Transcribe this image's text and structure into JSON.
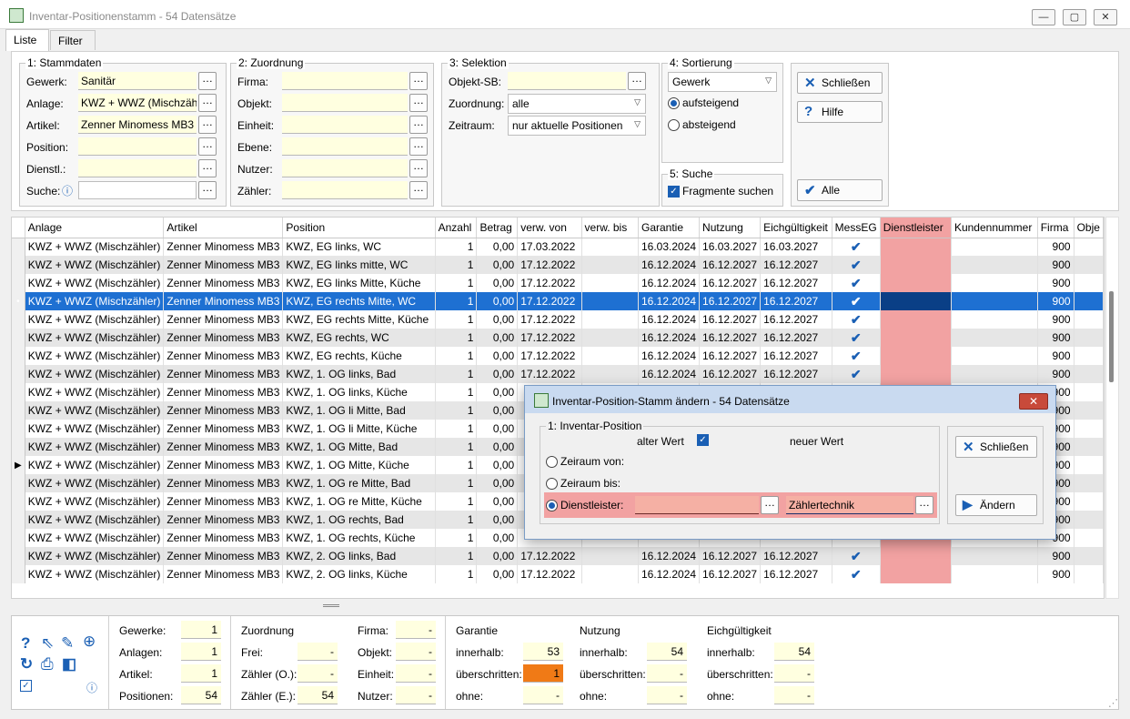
{
  "window": {
    "title": "Inventar-Positionenstamm - 54 Datensätze",
    "btn_min": "—",
    "btn_max": "▢",
    "btn_close": "✕"
  },
  "tabs": [
    "Liste",
    "Filter"
  ],
  "stammdaten": {
    "title": "1: Stammdaten",
    "rows": [
      {
        "label": "Gewerk:",
        "value": "Sanitär"
      },
      {
        "label": "Anlage:",
        "value": "KWZ + WWZ (Mischzäh"
      },
      {
        "label": "Artikel:",
        "value": "Zenner Minomess MB3"
      },
      {
        "label": "Position:",
        "value": ""
      },
      {
        "label": "Dienstl.:",
        "value": ""
      },
      {
        "label": "Suche:",
        "value": ""
      }
    ]
  },
  "zuordnung": {
    "title": "2: Zuordnung",
    "rows": [
      {
        "label": "Firma:",
        "value": ""
      },
      {
        "label": "Objekt:",
        "value": ""
      },
      {
        "label": "Einheit:",
        "value": ""
      },
      {
        "label": "Ebene:",
        "value": ""
      },
      {
        "label": "Nutzer:",
        "value": ""
      },
      {
        "label": "Zähler:",
        "value": ""
      }
    ]
  },
  "selektion": {
    "title": "3: Selektion",
    "objekt_label": "Objekt-SB:",
    "zuordnung_label": "Zuordnung:",
    "zuordnung_value": "alle",
    "zeitraum_label": "Zeitraum:",
    "zeitraum_value": "nur aktuelle Positionen"
  },
  "sortierung": {
    "title": "4: Sortierung",
    "value": "Gewerk",
    "asc": "aufsteigend",
    "desc": "absteigend"
  },
  "suche": {
    "title": "5: Suche",
    "fragment": "Fragmente suchen"
  },
  "buttons": {
    "schliessen": "Schließen",
    "hilfe": "Hilfe",
    "alle": "Alle"
  },
  "grid": {
    "columns": [
      "Anlage",
      "Artikel",
      "Position",
      "Anzahl",
      "Betrag",
      "verw. von",
      "verw. bis",
      "Garantie",
      "Nutzung",
      "Eichgültigkeit",
      "MessEG",
      "Dienstleister",
      "Kundennummer",
      "Firma",
      "Obje"
    ],
    "rows": [
      [
        "KWZ + WWZ (Mischzähler)",
        "Zenner Minomess MB3",
        "KWZ, EG links, WC",
        "1",
        "0,00",
        "17.03.2022",
        "",
        "16.03.2024",
        "16.03.2027",
        "16.03.2027",
        "✔",
        "",
        "",
        "900",
        ""
      ],
      [
        "KWZ + WWZ (Mischzähler)",
        "Zenner Minomess MB3",
        "KWZ, EG links mitte, WC",
        "1",
        "0,00",
        "17.12.2022",
        "",
        "16.12.2024",
        "16.12.2027",
        "16.12.2027",
        "✔",
        "",
        "",
        "900",
        ""
      ],
      [
        "KWZ + WWZ (Mischzähler)",
        "Zenner Minomess MB3",
        "KWZ, EG links Mitte, Küche",
        "1",
        "0,00",
        "17.12.2022",
        "",
        "16.12.2024",
        "16.12.2027",
        "16.12.2027",
        "✔",
        "",
        "",
        "900",
        ""
      ],
      [
        "KWZ + WWZ (Mischzähler)",
        "Zenner Minomess MB3",
        "KWZ, EG rechts Mitte, WC",
        "1",
        "0,00",
        "17.12.2022",
        "",
        "16.12.2024",
        "16.12.2027",
        "16.12.2027",
        "✔",
        "",
        "",
        "900",
        ""
      ],
      [
        "KWZ + WWZ (Mischzähler)",
        "Zenner Minomess MB3",
        "KWZ, EG rechts Mitte, Küche",
        "1",
        "0,00",
        "17.12.2022",
        "",
        "16.12.2024",
        "16.12.2027",
        "16.12.2027",
        "✔",
        "",
        "",
        "900",
        ""
      ],
      [
        "KWZ + WWZ (Mischzähler)",
        "Zenner Minomess MB3",
        "KWZ, EG rechts, WC",
        "1",
        "0,00",
        "17.12.2022",
        "",
        "16.12.2024",
        "16.12.2027",
        "16.12.2027",
        "✔",
        "",
        "",
        "900",
        ""
      ],
      [
        "KWZ + WWZ (Mischzähler)",
        "Zenner Minomess MB3",
        "KWZ, EG rechts, Küche",
        "1",
        "0,00",
        "17.12.2022",
        "",
        "16.12.2024",
        "16.12.2027",
        "16.12.2027",
        "✔",
        "",
        "",
        "900",
        ""
      ],
      [
        "KWZ + WWZ (Mischzähler)",
        "Zenner Minomess MB3",
        "KWZ, 1. OG links, Bad",
        "1",
        "0,00",
        "17.12.2022",
        "",
        "16.12.2024",
        "16.12.2027",
        "16.12.2027",
        "✔",
        "",
        "",
        "900",
        ""
      ],
      [
        "KWZ + WWZ (Mischzähler)",
        "Zenner Minomess MB3",
        "KWZ, 1. OG links, Küche",
        "1",
        "0,00",
        "",
        "",
        "",
        "",
        "",
        "",
        "",
        "",
        "900",
        ""
      ],
      [
        "KWZ + WWZ (Mischzähler)",
        "Zenner Minomess MB3",
        "KWZ, 1. OG li Mitte, Bad",
        "1",
        "0,00",
        "",
        "",
        "",
        "",
        "",
        "",
        "",
        "",
        "900",
        ""
      ],
      [
        "KWZ + WWZ (Mischzähler)",
        "Zenner Minomess MB3",
        "KWZ, 1. OG li Mitte, Küche",
        "1",
        "0,00",
        "",
        "",
        "",
        "",
        "",
        "",
        "",
        "",
        "900",
        ""
      ],
      [
        "KWZ + WWZ (Mischzähler)",
        "Zenner Minomess MB3",
        "KWZ, 1. OG Mitte, Bad",
        "1",
        "0,00",
        "",
        "",
        "",
        "",
        "",
        "",
        "",
        "",
        "900",
        ""
      ],
      [
        "KWZ + WWZ (Mischzähler)",
        "Zenner Minomess MB3",
        "KWZ, 1. OG Mitte, Küche",
        "1",
        "0,00",
        "",
        "",
        "",
        "",
        "",
        "",
        "",
        "",
        "900",
        ""
      ],
      [
        "KWZ + WWZ (Mischzähler)",
        "Zenner Minomess MB3",
        "KWZ, 1. OG re Mitte, Bad",
        "1",
        "0,00",
        "",
        "",
        "",
        "",
        "",
        "",
        "",
        "",
        "900",
        ""
      ],
      [
        "KWZ + WWZ (Mischzähler)",
        "Zenner Minomess MB3",
        "KWZ, 1. OG re Mitte, Küche",
        "1",
        "0,00",
        "",
        "",
        "",
        "",
        "",
        "",
        "",
        "",
        "900",
        ""
      ],
      [
        "KWZ + WWZ (Mischzähler)",
        "Zenner Minomess MB3",
        "KWZ, 1. OG rechts, Bad",
        "1",
        "0,00",
        "",
        "",
        "",
        "",
        "",
        "",
        "",
        "",
        "900",
        ""
      ],
      [
        "KWZ + WWZ (Mischzähler)",
        "Zenner Minomess MB3",
        "KWZ, 1. OG rechts, Küche",
        "1",
        "0,00",
        "",
        "",
        "",
        "",
        "",
        "",
        "",
        "",
        "900",
        ""
      ],
      [
        "KWZ + WWZ (Mischzähler)",
        "Zenner Minomess MB3",
        "KWZ, 2. OG links, Bad",
        "1",
        "0,00",
        "17.12.2022",
        "",
        "16.12.2024",
        "16.12.2027",
        "16.12.2027",
        "✔",
        "",
        "",
        "900",
        ""
      ],
      [
        "KWZ + WWZ (Mischzähler)",
        "Zenner Minomess MB3",
        "KWZ, 2. OG links, Küche",
        "1",
        "0,00",
        "17.12.2022",
        "",
        "16.12.2024",
        "16.12.2027",
        "16.12.2027",
        "✔",
        "",
        "",
        "900",
        ""
      ]
    ],
    "selected_marker": "•",
    "current_marker": "▶"
  },
  "footer": {
    "stats": [
      {
        "label": "Gewerke:",
        "value": "1"
      },
      {
        "label": "Anlagen:",
        "value": "1"
      },
      {
        "label": "Artikel:",
        "value": "1"
      },
      {
        "label": "Positionen:",
        "value": "54"
      }
    ],
    "zuordnung_title": "Zuordnung",
    "zuordnung": [
      {
        "label": "Frei:",
        "value": "-"
      },
      {
        "label": "Zähler (O.):",
        "value": "-"
      },
      {
        "label": "Zähler (E.):",
        "value": "54"
      }
    ],
    "zuordnung2": [
      {
        "label": "Firma:",
        "value": "-"
      },
      {
        "label": "Objekt:",
        "value": "-"
      },
      {
        "label": "Einheit:",
        "value": "-"
      },
      {
        "label": "Nutzer:",
        "value": "-"
      }
    ],
    "garantie": {
      "title": "Garantie",
      "innerhalb": "53",
      "ueberschritten": "1",
      "ohne": "-"
    },
    "nutzung": {
      "title": "Nutzung",
      "innerhalb": "54",
      "ueberschritten": "-",
      "ohne": "-"
    },
    "eich": {
      "title": "Eichgültigkeit",
      "innerhalb": "54",
      "ueberschritten": "-",
      "ohne": "-"
    },
    "labels": {
      "innerhalb": "innerhalb:",
      "ueberschritten": "überschritten:",
      "ohne": "ohne:"
    }
  },
  "dialog": {
    "title": "Inventar-Position-Stamm ändern - 54 Datensätze",
    "group": "1: Inventar-Position",
    "alter_wert": "alter Wert",
    "neuer_wert": "neuer Wert",
    "opt1": "Zeiraum von:",
    "opt2": "Zeiraum bis:",
    "opt3": "Dienstleister:",
    "new_value": "Zählertechnik",
    "schliessen": "Schließen",
    "aendern": "Ändern",
    "close_x": "✕"
  }
}
